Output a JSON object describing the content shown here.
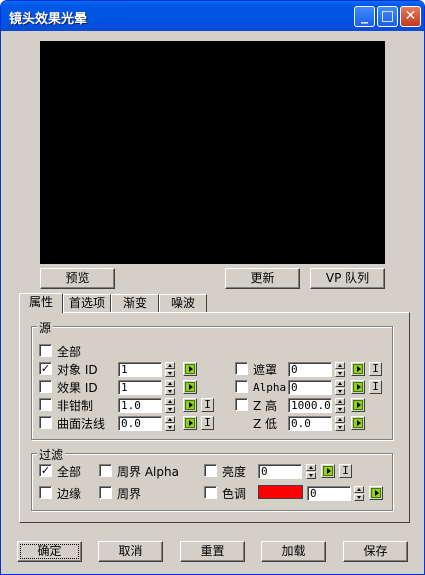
{
  "window": {
    "title": "镜头效果光晕"
  },
  "titlebar_buttons": {
    "minimize": "_",
    "maximize": "□",
    "close": "✕"
  },
  "preview_buttons": {
    "preview": "预览",
    "update": "更新",
    "vp_queue": "VP 队列"
  },
  "tabs": [
    "属性",
    "首选项",
    "渐变",
    "噪波"
  ],
  "source": {
    "label": "源",
    "all": {
      "label": "全部",
      "checked": false
    },
    "object_id": {
      "label": "对象 ID",
      "checked": true,
      "value": "1"
    },
    "effect_id": {
      "label": "效果 ID",
      "checked": false,
      "value": "1"
    },
    "unclamped": {
      "label": "非钳制",
      "checked": false,
      "value": "1.0"
    },
    "surface_normal": {
      "label": "曲面法线",
      "checked": false,
      "value": "0.0"
    },
    "mask": {
      "label": "遮罩",
      "checked": false,
      "value": "0"
    },
    "alpha": {
      "label": "Alpha",
      "checked": false,
      "value": "0"
    },
    "z_hi": {
      "label": "Z 高",
      "checked": false,
      "value": "1000.0"
    },
    "z_lo": {
      "label": "Z 低",
      "value": "0.0"
    }
  },
  "filter": {
    "label": "过滤",
    "all": {
      "label": "全部",
      "checked": true
    },
    "perimeter_alpha": {
      "label": "周界 Alpha",
      "checked": false
    },
    "brightness": {
      "label": "亮度",
      "checked": false,
      "value": "0"
    },
    "edge": {
      "label": "边缘",
      "checked": false
    },
    "perimeter": {
      "label": "周界",
      "checked": false
    },
    "hue": {
      "label": "色调",
      "checked": false,
      "value": "0",
      "color": "#ff0000"
    }
  },
  "invert_label": "I",
  "bottom_buttons": {
    "ok": "确定",
    "cancel": "取消",
    "reset": "重置",
    "load": "加载",
    "save": "保存"
  }
}
